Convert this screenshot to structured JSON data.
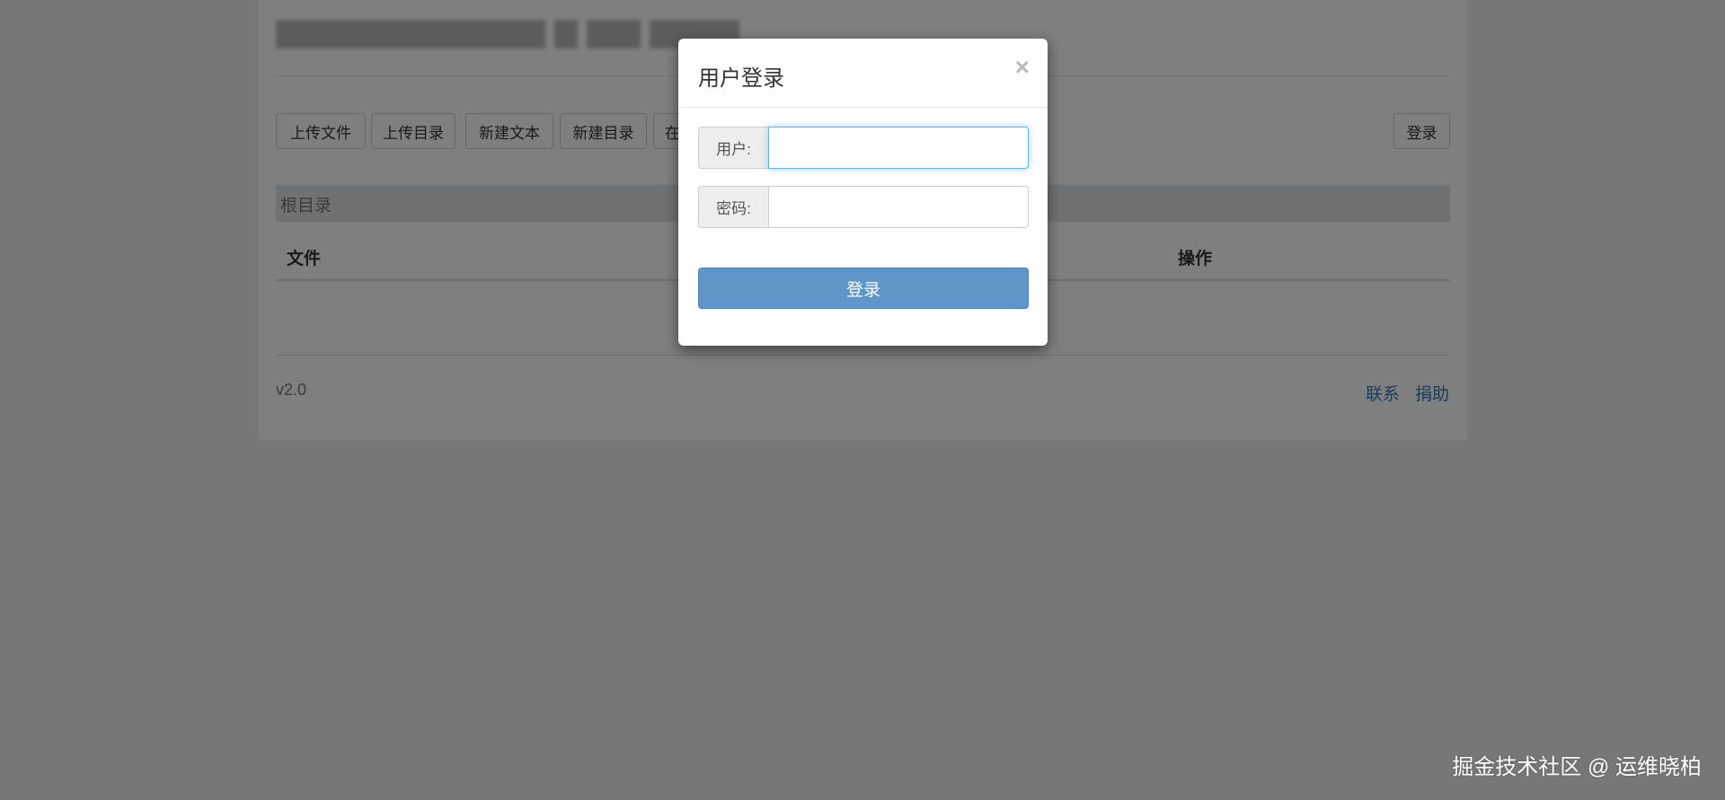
{
  "toolbar": {
    "buttons": [
      "上传文件",
      "上传目录",
      "新建文本",
      "新建目录",
      "在"
    ],
    "login": "登录"
  },
  "breadcrumb": "根目录",
  "table": {
    "headers": [
      "文件",
      "操作"
    ]
  },
  "footer": {
    "version": "v2.0",
    "links": [
      "联系",
      "捐助"
    ]
  },
  "modal": {
    "title": "用户登录",
    "close": "×",
    "user_label": "用户:",
    "password_label": "密码:",
    "user_value": "",
    "password_value": "",
    "submit": "登录"
  },
  "watermark": "掘金技术社区 @ 运维晓柏",
  "colors": {
    "primary": "#5e96c9",
    "link": "#337ab7"
  }
}
